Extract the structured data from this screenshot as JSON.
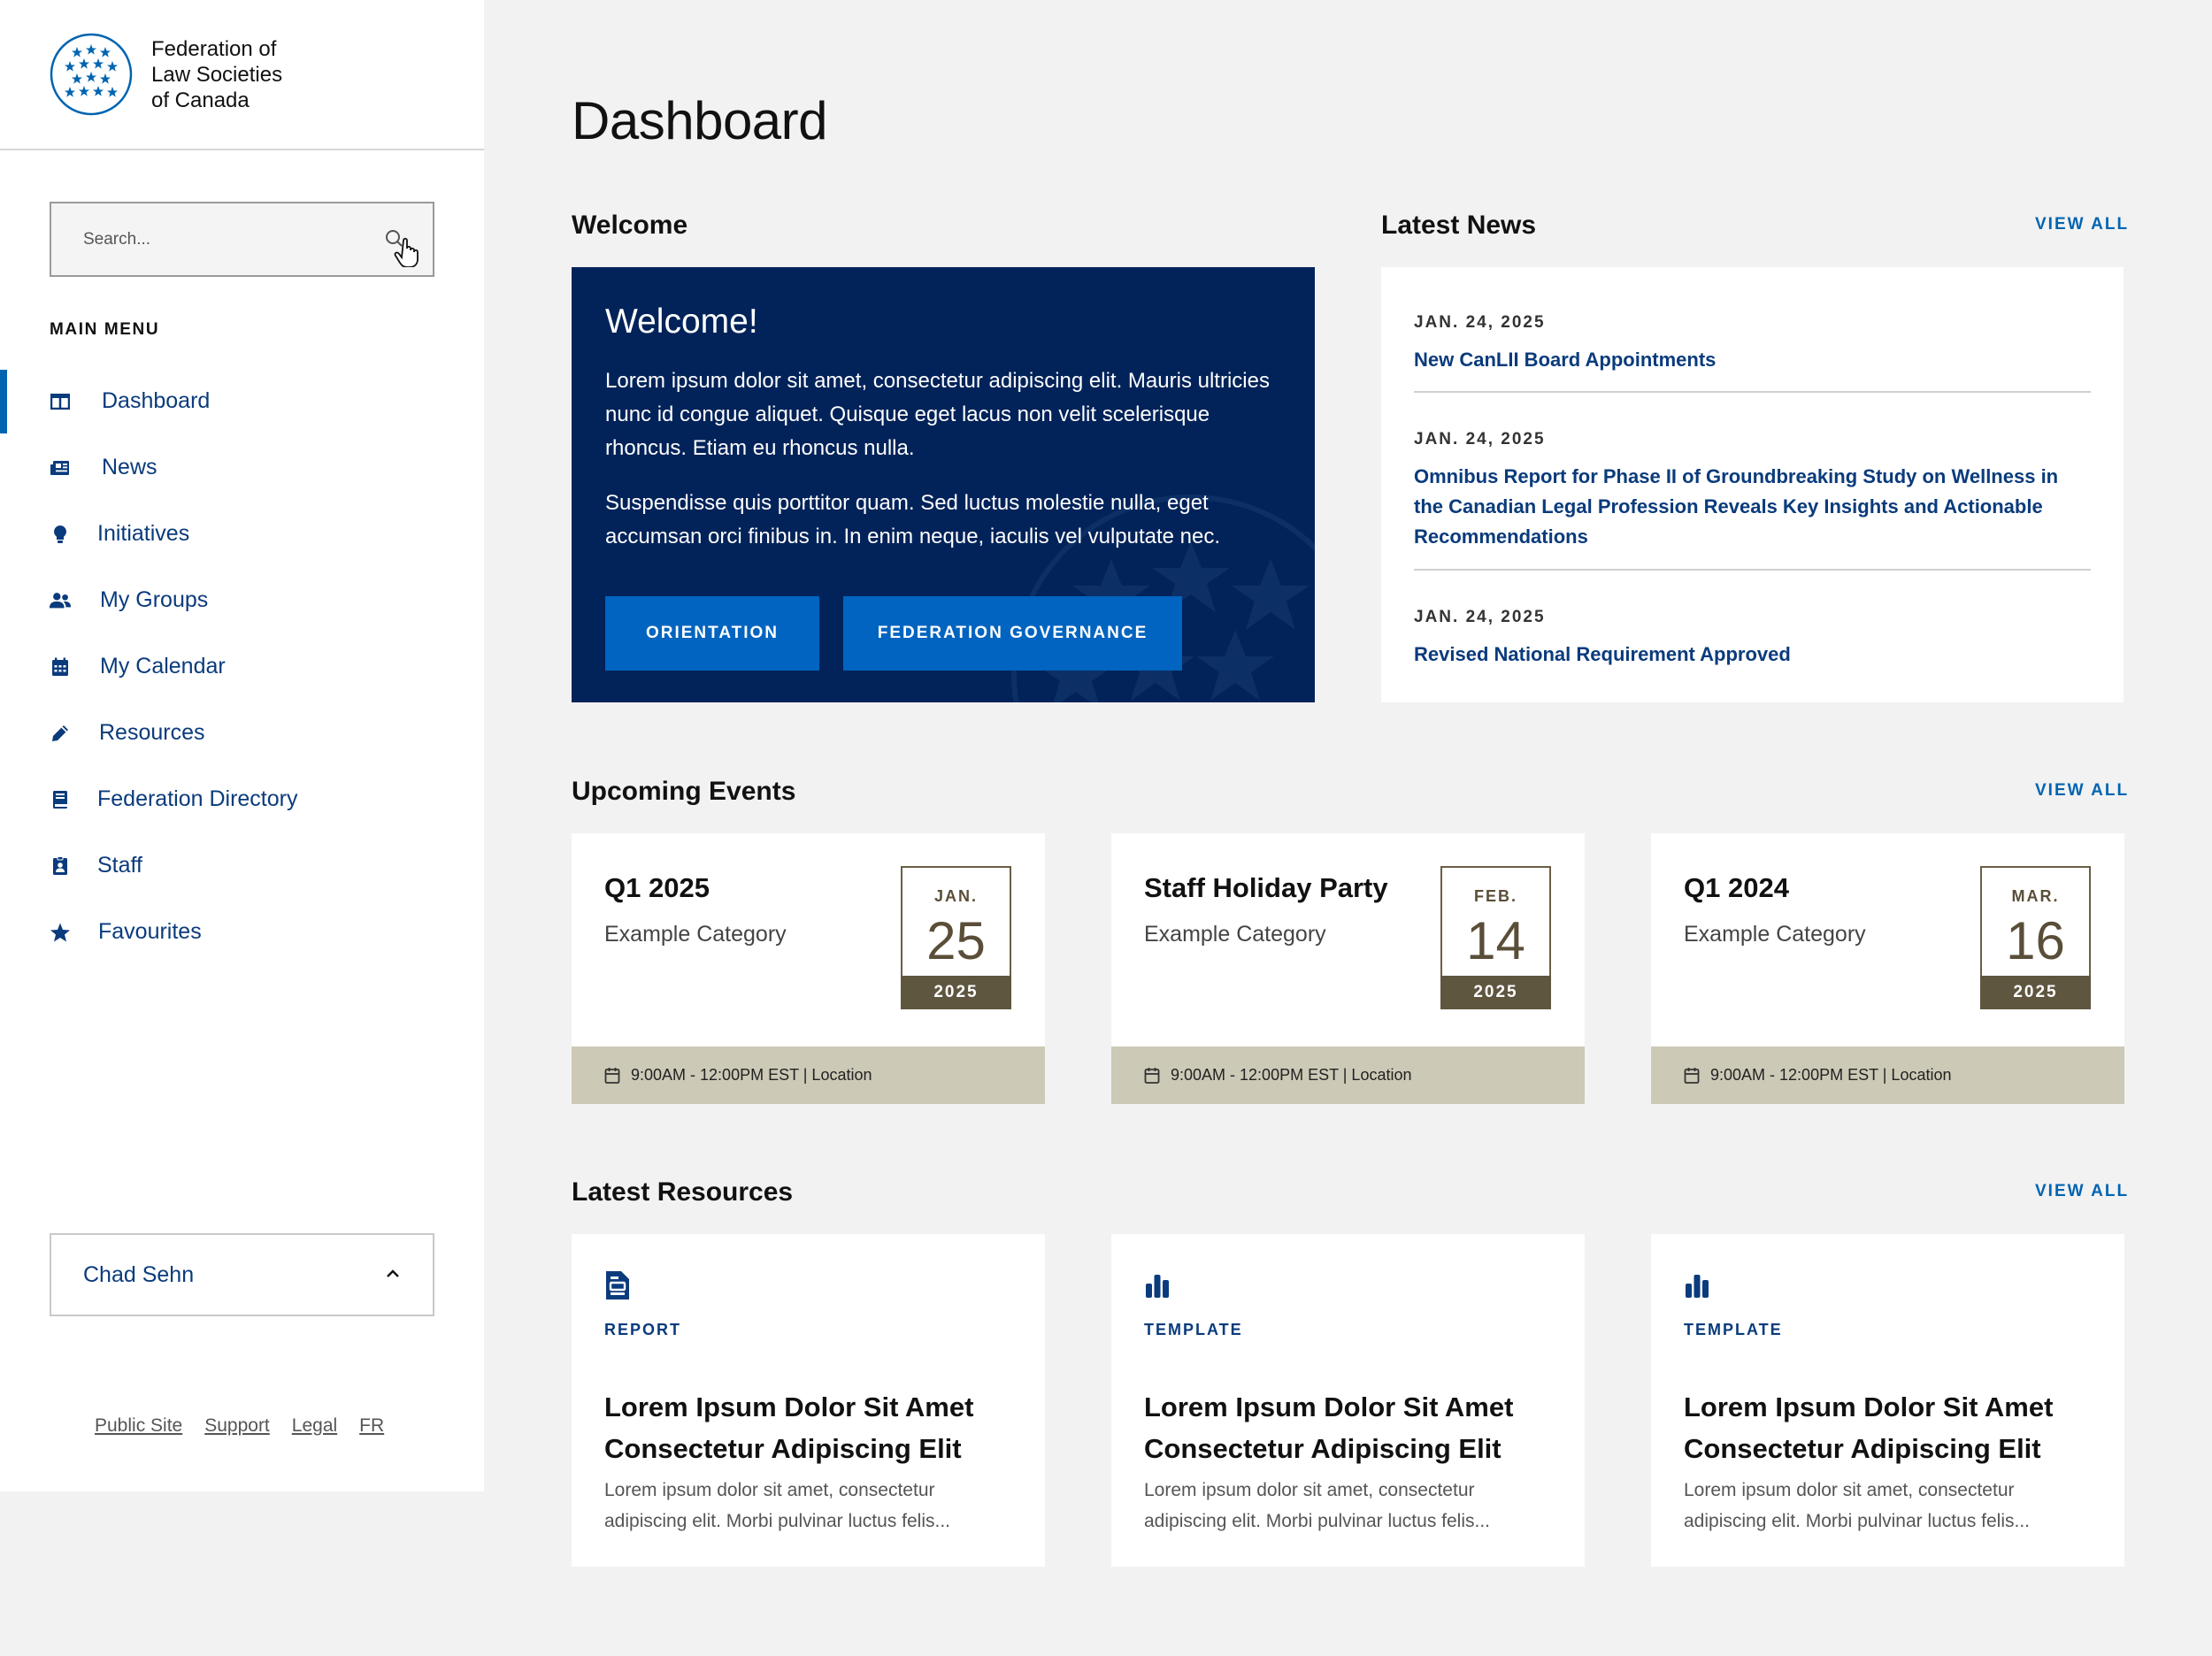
{
  "brand": {
    "line1": "Federation of",
    "line2": "Law Societies",
    "line3": "of Canada",
    "primary_color": "#0064b1",
    "navy_color": "#022359"
  },
  "search": {
    "placeholder": "Search..."
  },
  "sidebar": {
    "menu_title": "MAIN MENU",
    "items": [
      {
        "label": "Dashboard",
        "icon": "columns-icon",
        "active": true
      },
      {
        "label": "News",
        "icon": "newspaper-icon"
      },
      {
        "label": "Initiatives",
        "icon": "lightbulb-icon"
      },
      {
        "label": "My Groups",
        "icon": "users-icon"
      },
      {
        "label": "My Calendar",
        "icon": "calendar-icon"
      },
      {
        "label": "Resources",
        "icon": "pencil-icon"
      },
      {
        "label": "Federation Directory",
        "icon": "book-icon"
      },
      {
        "label": "Staff",
        "icon": "id-badge-icon"
      },
      {
        "label": "Favourites",
        "icon": "star-icon"
      }
    ],
    "user": {
      "name": "Chad Sehn"
    },
    "footer_links": [
      "Public Site",
      "Support",
      "Legal",
      "FR"
    ]
  },
  "main": {
    "title": "Dashboard",
    "welcome_section": "Welcome",
    "welcome": {
      "heading": "Welcome!",
      "paragraph1": "Lorem ipsum dolor sit amet, consectetur adipiscing elit. Mauris ultricies nunc id congue aliquet. Quisque eget lacus non velit scelerisque rhoncus. Etiam eu rhoncus nulla.",
      "paragraph2": "Suspendisse quis porttitor quam. Sed luctus molestie nulla, eget accumsan orci finibus in. In enim neque, iaculis vel vulputate nec.",
      "button1": "ORIENTATION",
      "button2": "FEDERATION GOVERNANCE"
    },
    "news_section": "Latest News",
    "view_all": "VIEW ALL",
    "news": [
      {
        "date": "JAN. 24, 2025",
        "title": "New CanLII Board Appointments"
      },
      {
        "date": "JAN. 24, 2025",
        "title": "Omnibus Report for Phase II of Groundbreaking Study on Wellness in the Canadian Legal Profession Reveals Key Insights and Actionable Recommendations"
      },
      {
        "date": "JAN. 24, 2025",
        "title": "Revised National Requirement Approved"
      }
    ],
    "events_section": "Upcoming Events",
    "events": [
      {
        "title": "Q1 2025",
        "category": "Example Category",
        "month": "JAN.",
        "day": "25",
        "year": "2025",
        "details": "9:00AM - 12:00PM EST | Location"
      },
      {
        "title": "Staff Holiday Party",
        "category": "Example Category",
        "month": "FEB.",
        "day": "14",
        "year": "2025",
        "details": "9:00AM - 12:00PM EST | Location"
      },
      {
        "title": "Q1 2024",
        "category": "Example Category",
        "month": "MAR.",
        "day": "16",
        "year": "2025",
        "details": "9:00AM - 12:00PM EST | Location"
      }
    ],
    "resources_section": "Latest Resources",
    "resources": [
      {
        "type": "REPORT",
        "icon": "report-icon",
        "title": "Lorem Ipsum Dolor Sit Amet Consectetur Adipiscing Elit",
        "description": "Lorem ipsum dolor sit amet, consectetur adipiscing elit. Morbi pulvinar luctus felis..."
      },
      {
        "type": "TEMPLATE",
        "icon": "bar-chart-icon",
        "title": "Lorem Ipsum Dolor Sit Amet Consectetur Adipiscing Elit",
        "description": "Lorem ipsum dolor sit amet, consectetur adipiscing elit. Morbi pulvinar luctus felis..."
      },
      {
        "type": "TEMPLATE",
        "icon": "bar-chart-icon",
        "title": "Lorem Ipsum Dolor Sit Amet Consectetur Adipiscing Elit",
        "description": "Lorem ipsum dolor sit amet, consectetur adipiscing elit. Morbi pulvinar luctus felis..."
      }
    ]
  }
}
